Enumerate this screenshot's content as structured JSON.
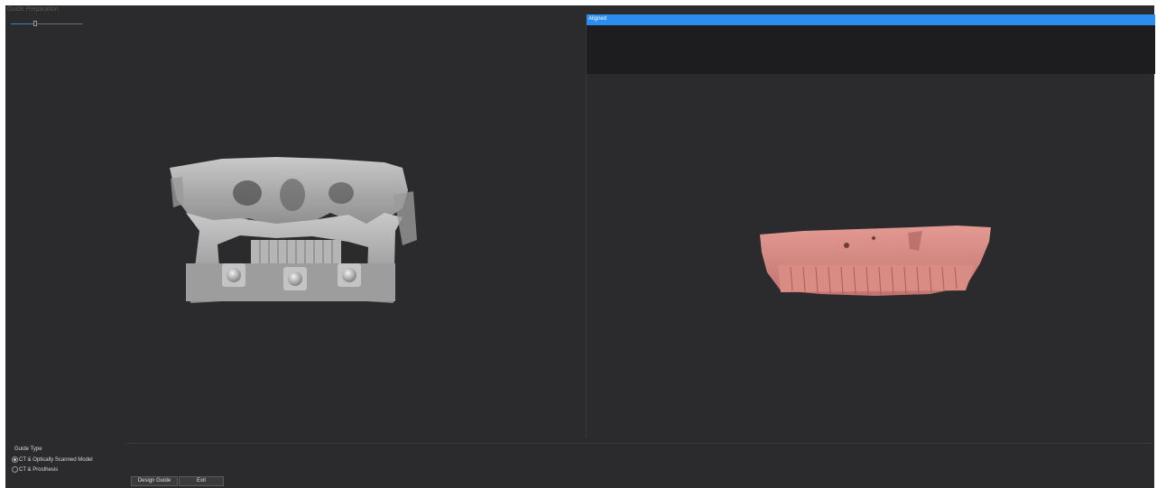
{
  "window": {
    "title": "Guide Preparation"
  },
  "slider": {
    "value_fraction": 0.34
  },
  "right_panel": {
    "header_label": "Aligned"
  },
  "guide_type": {
    "label": "Guide Type",
    "options": [
      {
        "label": "CT & Optically Scanned Model",
        "selected": true
      },
      {
        "label": "CT & Prosthesis",
        "selected": false
      }
    ]
  },
  "buttons": {
    "design_guide": "Design Guide",
    "exit": "Exit"
  },
  "colors": {
    "accent": "#2b8df0",
    "background": "#2b2b2d",
    "ct_model": "#b9b9b9",
    "scan_model": "#d98b84"
  }
}
